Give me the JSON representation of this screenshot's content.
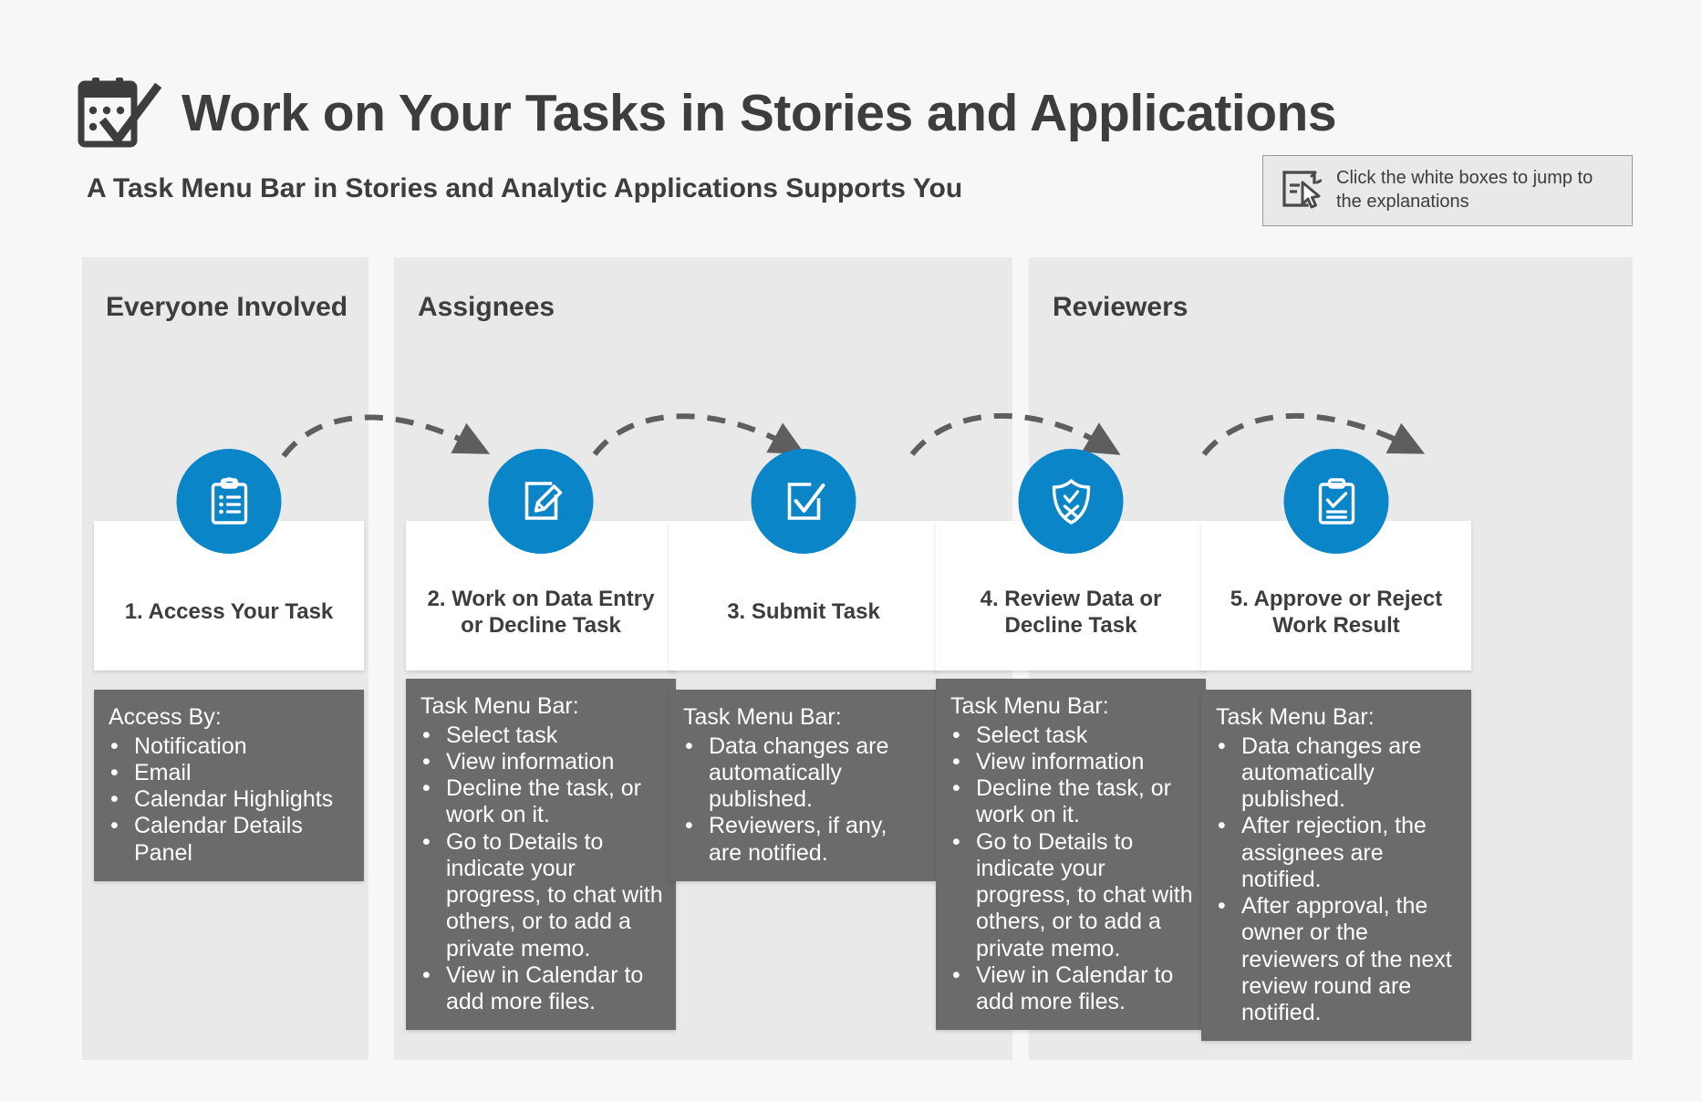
{
  "header": {
    "title": "Work on Your Tasks in Stories and Applications",
    "subtitle": "A Task Menu Bar in Stories and Analytic Applications Supports You",
    "title_icon": "calendar-check-icon"
  },
  "callout": {
    "icon": "click-cursor-icon",
    "text": "Click the white boxes to jump to the explanations"
  },
  "colors": {
    "page_background": "#f7f7f7",
    "lane_background": "#e9e9e9",
    "accent_blue": "#0a85c8",
    "detail_box": "#6b6b6b",
    "text_dark": "#3d3d3d",
    "card_white": "#ffffff",
    "arrow_gray": "#5e5e5e"
  },
  "lanes": [
    {
      "title": "Everyone Involved"
    },
    {
      "title": "Assignees"
    },
    {
      "title": "Reviewers"
    }
  ],
  "steps": [
    {
      "icon": "clipboard-list-icon",
      "label": "1. Access Your Task",
      "detail": {
        "heading": "Access By:",
        "items": [
          "Notification",
          "Email",
          "Calendar Highlights",
          "Calendar Details Panel"
        ]
      }
    },
    {
      "icon": "edit-square-pencil-icon",
      "label": "2. Work on Data Entry or Decline Task",
      "detail": {
        "heading": "Task Menu Bar:",
        "items": [
          "Select task",
          "View information",
          "Decline the task, or work on it.",
          "Go to Details to indicate your progress, to chat with others, or to add a private memo.",
          "View in Calendar to add more files."
        ]
      }
    },
    {
      "icon": "check-square-icon",
      "label": "3. Submit Task",
      "detail": {
        "heading": "Task Menu Bar:",
        "items": [
          "Data changes are automatically published.",
          "Reviewers, if any, are notified."
        ]
      }
    },
    {
      "icon": "shield-check-x-icon",
      "label": "4. Review Data or Decline Task",
      "detail": {
        "heading": "Task Menu Bar:",
        "items": [
          "Select task",
          "View information",
          "Decline the task, or work on it.",
          "Go to Details to indicate your progress, to chat with others, or to add a private memo.",
          "View in Calendar to add more files."
        ]
      }
    },
    {
      "icon": "clipboard-check-icon",
      "label": "5. Approve or Reject Work Result",
      "detail": {
        "heading": "Task Menu Bar:",
        "items": [
          "Data changes are automatically published.",
          "After rejection, the assignees are notified.",
          "After approval, the owner or the reviewers of the next review round are notified."
        ]
      }
    }
  ],
  "flow_arrows": [
    {
      "from": "1. Access Your Task",
      "to": "2. Work on Data Entry or Decline Task",
      "style": "dashed-curved"
    },
    {
      "from": "2. Work on Data Entry or Decline Task",
      "to": "3. Submit Task",
      "style": "dashed-curved"
    },
    {
      "from": "3. Submit Task",
      "to": "4. Review Data or Decline Task",
      "style": "dashed-curved"
    },
    {
      "from": "4. Review Data or Decline Task",
      "to": "5. Approve or Reject Work Result",
      "style": "dashed-curved"
    }
  ]
}
